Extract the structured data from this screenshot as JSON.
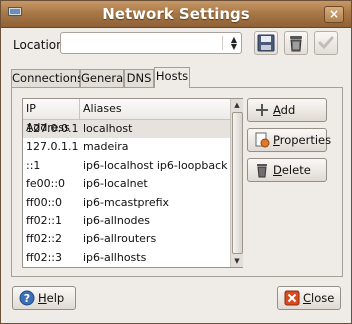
{
  "window": {
    "title": "Network Settings",
    "close_glyph": "×"
  },
  "location": {
    "label": "Location:",
    "value": ""
  },
  "tabs": [
    {
      "label": "Connections"
    },
    {
      "label": "General"
    },
    {
      "label": "DNS"
    },
    {
      "label": "Hosts",
      "active": true
    }
  ],
  "hosts": {
    "headers": {
      "ip": "IP Address",
      "aliases": "Aliases"
    },
    "rows": [
      {
        "ip": "127.0.0.1",
        "aliases": "localhost"
      },
      {
        "ip": "127.0.1.1",
        "aliases": "madeira"
      },
      {
        "ip": "::1",
        "aliases": "ip6-localhost ip6-loopback"
      },
      {
        "ip": "fe00::0",
        "aliases": "ip6-localnet"
      },
      {
        "ip": "ff00::0",
        "aliases": "ip6-mcastprefix"
      },
      {
        "ip": "ff02::1",
        "aliases": "ip6-allnodes"
      },
      {
        "ip": "ff02::2",
        "aliases": "ip6-allrouters"
      },
      {
        "ip": "ff02::3",
        "aliases": "ip6-allhosts"
      }
    ],
    "selected_row": 0
  },
  "buttons": {
    "add": {
      "mnemonic": "A",
      "rest": "dd"
    },
    "properties": {
      "mnemonic": "P",
      "rest": "roperties"
    },
    "delete": {
      "mnemonic": "D",
      "rest": "elete"
    },
    "help": {
      "mnemonic": "H",
      "rest": "elp"
    },
    "close": {
      "mnemonic": "C",
      "rest": "lose"
    }
  },
  "icons": {
    "window": "network-icon",
    "close": "close-icon",
    "save": "floppy-disk-icon",
    "delete_location": "trash-icon",
    "apply": "checkmark-icon",
    "add": "plus-icon",
    "properties": "properties-icon",
    "delete": "trash-icon",
    "help": "help-icon",
    "close_dialog": "close-x-icon"
  },
  "colors": {
    "accent": "#a97847",
    "selection": "#e6e3df",
    "close_red": "#d94a20",
    "help_blue": "#3b6fb6"
  }
}
